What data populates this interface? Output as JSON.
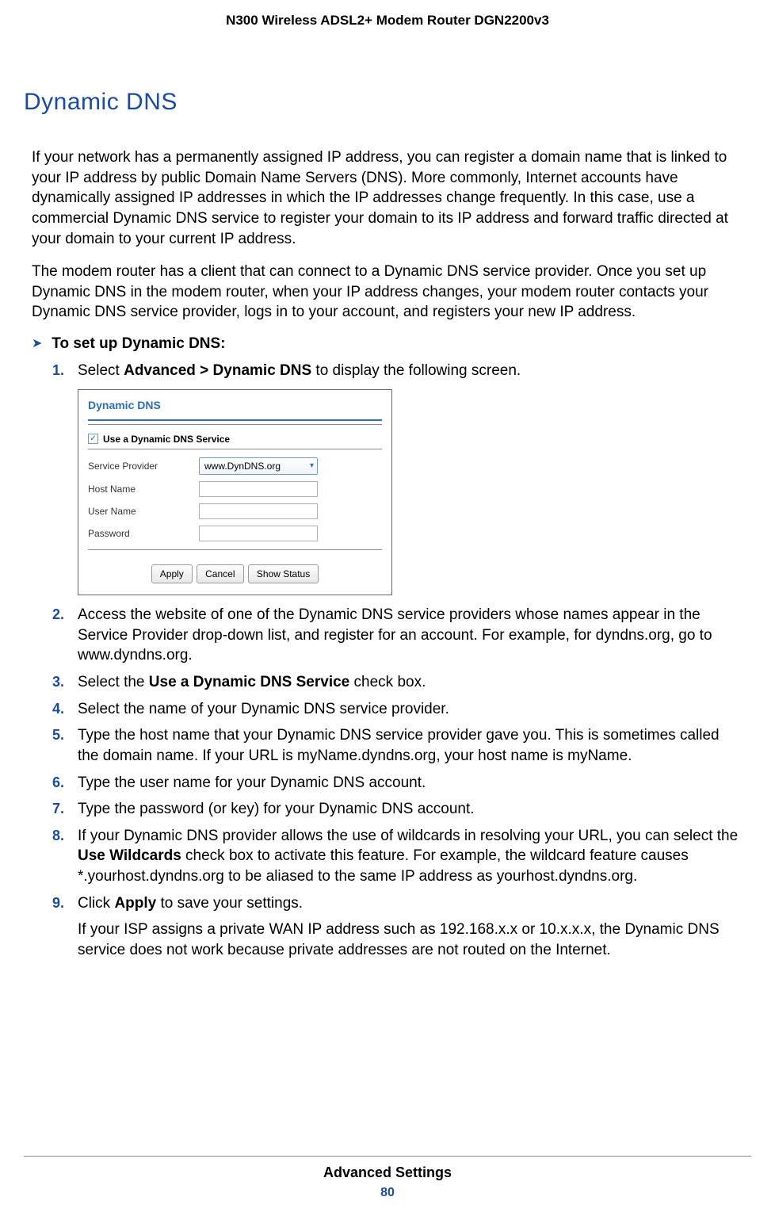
{
  "header": {
    "product": "N300 Wireless ADSL2+ Modem Router DGN2200v3"
  },
  "title": "Dynamic DNS",
  "paragraphs": {
    "p1": "If your network has a permanently assigned IP address, you can register a domain name that is linked to your IP address by public Domain Name Servers (DNS). More commonly, Internet accounts have dynamically assigned IP addresses in which the IP addresses change frequently. In this case, use a commercial Dynamic DNS service to register your domain to its IP address and forward traffic directed at your domain to your current IP address.",
    "p2": "The modem router has a client that can connect to a Dynamic DNS service provider. Once you set up Dynamic DNS in the modem router, when your IP address changes, your modem router contacts your Dynamic DNS service provider, logs in to your account, and registers your new IP address."
  },
  "task": {
    "heading": "To set up Dynamic DNS:"
  },
  "steps": {
    "s1_prefix": "Select ",
    "s1_bold": "Advanced > Dynamic DNS",
    "s1_suffix": " to display the following screen.",
    "s2": "Access the website of one of the Dynamic DNS service providers whose names appear in the Service Provider drop-down list, and register for an account. For example, for dyndns.org, go to www.dyndns.org.",
    "s3_prefix": "Select the ",
    "s3_bold": "Use a Dynamic DNS Service",
    "s3_suffix": " check box.",
    "s4": "Select the name of your Dynamic DNS service provider.",
    "s5": "Type the host name that your Dynamic DNS service provider gave you. This is sometimes called the domain name. If your URL is myName.dyndns.org, your host name is myName.",
    "s6": "Type the user name for your Dynamic DNS account.",
    "s7": "Type the password (or key) for your Dynamic DNS account.",
    "s8_prefix": "If your Dynamic DNS provider allows the use of wildcards in resolving your URL, you can select the ",
    "s8_bold": "Use Wildcards",
    "s8_suffix": " check box to activate this feature. For example, the wildcard feature causes *.yourhost.dyndns.org to be aliased to the same IP address as yourhost.dyndns.org.",
    "s9_prefix": "Click ",
    "s9_bold": "Apply",
    "s9_suffix": " to save your settings.",
    "s9_after": "If your ISP assigns a private WAN IP address such as 192.168.x.x or 10.x.x.x, the Dynamic DNS service does not work because private addresses are not routed on the Internet."
  },
  "screenshot": {
    "title": "Dynamic DNS",
    "checkbox_label": "Use a Dynamic DNS Service",
    "checkbox_mark": "✓",
    "rows": {
      "provider_label": "Service Provider",
      "provider_value": "www.DynDNS.org",
      "hostname_label": "Host Name",
      "username_label": "User Name",
      "password_label": "Password"
    },
    "buttons": {
      "apply": "Apply",
      "cancel": "Cancel",
      "show_status": "Show Status"
    }
  },
  "footer": {
    "section": "Advanced Settings",
    "page": "80"
  }
}
